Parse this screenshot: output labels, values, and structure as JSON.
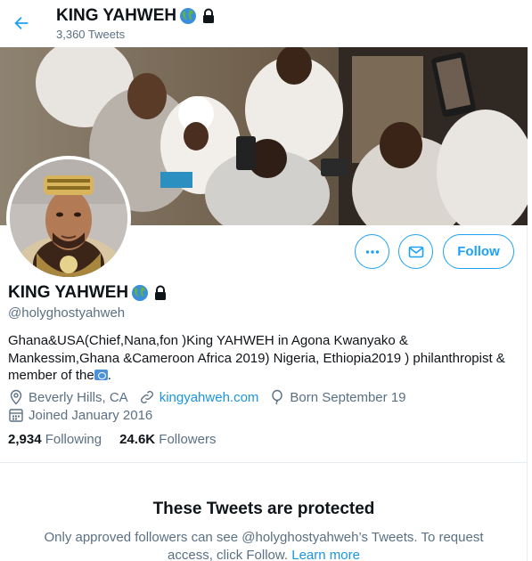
{
  "header": {
    "title": "KING YAHWEH",
    "tweet_count": "3,360 Tweets"
  },
  "profile": {
    "name": "KING YAHWEH",
    "handle": "@holyghostyahweh",
    "bio_text": "Ghana&USA(Chief,Nana,fon )King YAHWEH in Agona Kwanyako & Mankessim,Ghana &Cameroon Africa 2019) Nigeria, Ethiopia2019 ) philanthropist & member of the",
    "bio_end": ".",
    "location": "Beverly Hills, CA",
    "website": "kingyahweh.com",
    "birthday": "Born September 19",
    "joined": "Joined January 2016"
  },
  "stats": {
    "following_count": "2,934",
    "following_label": "Following",
    "followers_count": "24.6K",
    "followers_label": "Followers"
  },
  "actions": {
    "follow_label": "Follow"
  },
  "protected": {
    "title": "These Tweets are protected",
    "message": "Only approved followers can see @holyghostyahweh’s Tweets. To request access, click Follow.",
    "learn_more": "Learn more"
  },
  "colors": {
    "accent": "#1da1f2",
    "link": "#1b95e0",
    "secondary_text": "#5b7083",
    "primary_text": "#0f1419",
    "border": "#e6ecf0"
  },
  "icons": {
    "back": "arrow-left-icon",
    "globe": "globe-emoji-icon",
    "lock": "lock-icon",
    "more": "more-dots-icon",
    "message": "envelope-icon",
    "location": "location-pin-icon",
    "website": "link-icon",
    "birthday": "balloon-icon",
    "joined": "calendar-icon"
  }
}
